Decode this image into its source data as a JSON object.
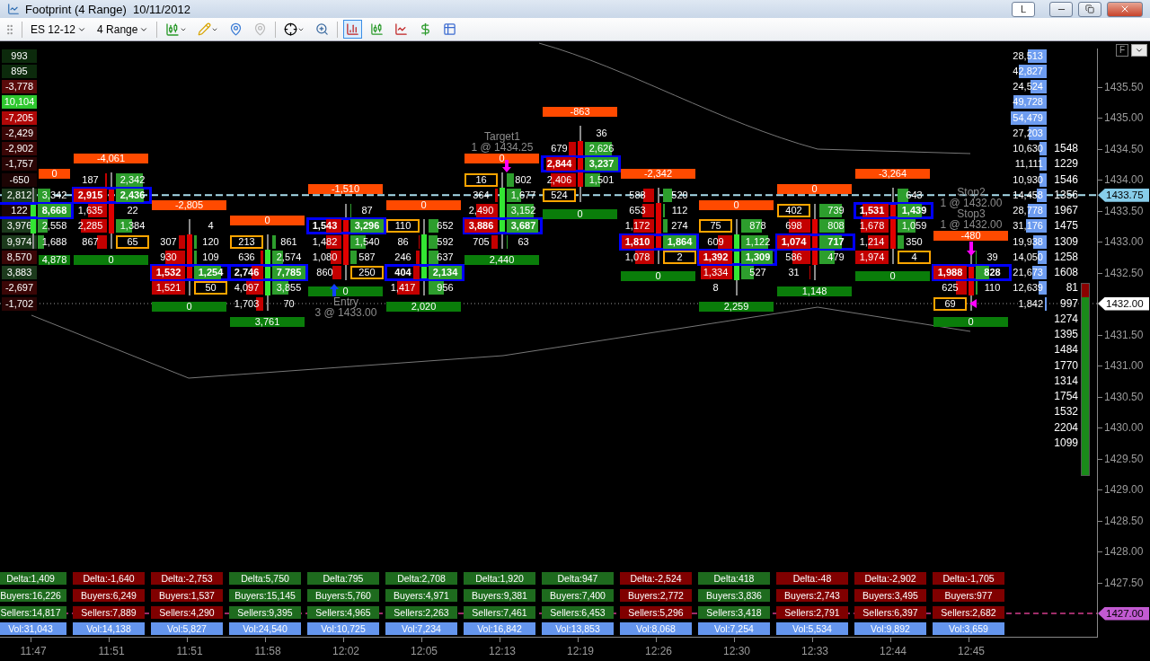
{
  "window": {
    "title": "Footprint (4 Range)  10/11/2012",
    "link_button": "L"
  },
  "toolbar": {
    "instrument": "ES 12-12",
    "period": "4 Range",
    "views": [
      {
        "selected": true
      },
      {
        "selected": false
      },
      {
        "selected": false
      },
      {
        "selected": false
      },
      {
        "selected": false
      }
    ]
  },
  "chart": {
    "scale_button": "F",
    "ladder": [
      {
        "value": "993",
        "color": "#0c2a0c"
      },
      {
        "value": "895",
        "color": "#0c2a0c"
      },
      {
        "value": "-3,778",
        "color": "#5a0a0a"
      },
      {
        "value": "10,104",
        "color": "#2fc82f"
      },
      {
        "value": "-7,205",
        "color": "#b00808"
      },
      {
        "value": "-2,429",
        "color": "#3a0606"
      },
      {
        "value": "-2,902",
        "color": "#3a0606"
      },
      {
        "value": "-1,757",
        "color": "#2a0505"
      },
      {
        "value": "-650",
        "color": "#1c0404"
      },
      {
        "value": "2,812",
        "color": "#1c3a1c"
      },
      {
        "value": "122",
        "color": "#1c0404"
      },
      {
        "value": "3,976",
        "color": "#1c3a1c"
      },
      {
        "value": "9,974",
        "color": "#1c3a1c"
      },
      {
        "value": "8,570",
        "color": "#3a0606"
      },
      {
        "value": "3,883",
        "color": "#1c3a1c"
      },
      {
        "value": "-2,697",
        "color": "#3a0606"
      },
      {
        "value": "-1,702",
        "color": "#2a0505"
      }
    ],
    "bars": [
      {
        "time": "11:47",
        "bullish": true,
        "delta": "0",
        "total": "4,878",
        "stats": {
          "color": "#1e6b1e",
          "delta": "Delta:1,409",
          "buyers": "Buyers:16,226",
          "sellers": "Sellers:14,817",
          "volume": "Vol:31,043"
        }
      },
      {
        "time": "11:51",
        "bullish": false,
        "delta": "-4,061",
        "total": "0",
        "stats": {
          "color": "#800000",
          "delta": "Delta:-1,640",
          "buyers": "Buyers:6,249",
          "sellers": "Sellers:7,889",
          "volume": "Vol:14,138"
        }
      },
      {
        "time": "11:51",
        "bullish": false,
        "delta": "-2,805",
        "total": "0",
        "stats": {
          "color": "#800000",
          "delta": "Delta:-2,753",
          "buyers": "Buyers:1,537",
          "sellers": "Sellers:4,290",
          "volume": "Vol:5,827"
        }
      },
      {
        "time": "11:58",
        "bullish": true,
        "delta": "0",
        "total": "3,761",
        "stats": {
          "color": "#1e6b1e",
          "delta": "Delta:5,750",
          "buyers": "Buyers:15,145",
          "sellers": "Sellers:9,395",
          "volume": "Vol:24,540"
        }
      },
      {
        "time": "12:02",
        "bullish": false,
        "delta": "-1,510",
        "total": "0",
        "orders": [
          {
            "kind": "entry",
            "name": "Entry",
            "detail": "3 @ 1433.00"
          }
        ],
        "stats": {
          "color": "#1e6b1e",
          "delta": "Delta:795",
          "buyers": "Buyers:5,760",
          "sellers": "Sellers:4,965",
          "volume": "Vol:10,725"
        }
      },
      {
        "time": "12:05",
        "bullish": true,
        "delta": "0",
        "total": "2,020",
        "stats": {
          "color": "#1e6b1e",
          "delta": "Delta:2,708",
          "buyers": "Buyers:4,971",
          "sellers": "Sellers:2,263",
          "volume": "Vol:7,234"
        }
      },
      {
        "time": "12:13",
        "bullish": true,
        "delta": "0",
        "total": "2,440",
        "orders": [
          {
            "kind": "target",
            "name": "Target1",
            "detail": "1 @ 1434.25"
          }
        ],
        "stats": {
          "color": "#1e6b1e",
          "delta": "Delta:1,920",
          "buyers": "Buyers:9,381",
          "sellers": "Sellers:7,461",
          "volume": "Vol:16,842"
        }
      },
      {
        "time": "12:19",
        "bullish": false,
        "delta": "-863",
        "total": "0",
        "stats": {
          "color": "#1e6b1e",
          "delta": "Delta:947",
          "buyers": "Buyers:7,400",
          "sellers": "Sellers:6,453",
          "volume": "Vol:13,853"
        }
      },
      {
        "time": "12:26",
        "bullish": false,
        "delta": "-2,342",
        "total": "0",
        "stats": {
          "color": "#800000",
          "delta": "Delta:-2,524",
          "buyers": "Buyers:2,772",
          "sellers": "Sellers:5,296",
          "volume": "Vol:8,068"
        }
      },
      {
        "time": "12:30",
        "bullish": true,
        "delta": "0",
        "total": "2,259",
        "stats": {
          "color": "#1e6b1e",
          "delta": "Delta:418",
          "buyers": "Buyers:3,836",
          "sellers": "Sellers:3,418",
          "volume": "Vol:7,254"
        }
      },
      {
        "time": "12:33",
        "bullish": false,
        "delta": "0",
        "total": "1,148",
        "stats": {
          "color": "#800000",
          "delta": "Delta:-48",
          "buyers": "Buyers:2,743",
          "sellers": "Sellers:2,791",
          "volume": "Vol:5,534"
        }
      },
      {
        "time": "12:44",
        "bullish": false,
        "delta": "-3,264",
        "total": "0",
        "stats": {
          "color": "#800000",
          "delta": "Delta:-2,902",
          "buyers": "Buyers:3,495",
          "sellers": "Sellers:6,397",
          "volume": "Vol:9,892"
        }
      },
      {
        "time": "12:45",
        "bullish": false,
        "delta": "-480",
        "total": "0",
        "orders": [
          {
            "kind": "stop",
            "name": "Stop2",
            "detail": "1 @ 1432.00"
          },
          {
            "kind": "stop",
            "name": "Stop3",
            "detail": "1 @ 1432.00"
          }
        ],
        "stats": {
          "color": "#800000",
          "delta": "Delta:-1,705",
          "buyers": "Buyers:977",
          "sellers": "Sellers:2,682",
          "volume": "Vol:3,659"
        }
      }
    ],
    "footprint_rows": [
      {
        "cells": [
          {
            "kind": "empty"
          },
          {
            "kind": "empty"
          },
          {
            "kind": "empty"
          },
          {
            "kind": "empty"
          },
          {
            "kind": "empty"
          },
          {
            "kind": "empty"
          },
          {
            "kind": "empty"
          },
          {
            "kind": "plain",
            "ask": "36"
          },
          {
            "kind": "empty"
          },
          {
            "kind": "empty"
          },
          {
            "kind": "empty"
          },
          {
            "kind": "empty"
          },
          {
            "kind": "empty"
          }
        ]
      },
      {
        "cells": [
          {
            "kind": "empty"
          },
          {
            "kind": "empty"
          },
          {
            "kind": "empty"
          },
          {
            "kind": "empty"
          },
          {
            "kind": "empty"
          },
          {
            "kind": "empty"
          },
          {
            "kind": "empty"
          },
          {
            "kind": "plain",
            "bid": "679",
            "ask": "2,626"
          },
          {
            "kind": "empty"
          },
          {
            "kind": "empty"
          },
          {
            "kind": "empty"
          },
          {
            "kind": "empty"
          },
          {
            "kind": "empty"
          }
        ]
      },
      {
        "cells": [
          {
            "kind": "empty"
          },
          {
            "kind": "empty"
          },
          {
            "kind": "empty"
          },
          {
            "kind": "empty"
          },
          {
            "kind": "empty"
          },
          {
            "kind": "empty"
          },
          {
            "kind": "empty"
          },
          {
            "kind": "both",
            "bid": "2,844",
            "ask": "3,237"
          },
          {
            "kind": "empty"
          },
          {
            "kind": "empty"
          },
          {
            "kind": "empty"
          },
          {
            "kind": "empty"
          },
          {
            "kind": "empty"
          }
        ]
      },
      {
        "cells": [
          {
            "kind": "empty"
          },
          {
            "kind": "plain",
            "bid": "187",
            "ask": "2,342"
          },
          {
            "kind": "empty"
          },
          {
            "kind": "empty"
          },
          {
            "kind": "empty"
          },
          {
            "kind": "empty"
          },
          {
            "kind": "bid",
            "bid": "16",
            "ask": "802"
          },
          {
            "kind": "plain",
            "bid": "2,406",
            "ask": "1,501"
          },
          {
            "kind": "empty"
          },
          {
            "kind": "empty"
          },
          {
            "kind": "empty"
          },
          {
            "kind": "empty"
          },
          {
            "kind": "empty"
          }
        ]
      },
      {
        "cells": [
          {
            "kind": "plain",
            "ask": "3,342"
          },
          {
            "kind": "both",
            "bid": "2,915",
            "ask": "2,436"
          },
          {
            "kind": "empty"
          },
          {
            "kind": "empty"
          },
          {
            "kind": "empty"
          },
          {
            "kind": "empty"
          },
          {
            "kind": "plain",
            "bid": "364",
            "ask": "1,677"
          },
          {
            "kind": "bid",
            "bid": "524"
          },
          {
            "kind": "plain",
            "bid": "588",
            "ask": "520"
          },
          {
            "kind": "empty"
          },
          {
            "kind": "empty"
          },
          {
            "kind": "plain",
            "ask": "643"
          },
          {
            "kind": "empty"
          }
        ]
      },
      {
        "cells": [
          {
            "kind": "both",
            "ask": "8,668"
          },
          {
            "kind": "plain",
            "bid": "1,635",
            "ask": "22"
          },
          {
            "kind": "empty"
          },
          {
            "kind": "empty"
          },
          {
            "kind": "plain",
            "ask": "87"
          },
          {
            "kind": "empty"
          },
          {
            "kind": "plain",
            "bid": "2,490",
            "ask": "3,152"
          },
          {
            "kind": "empty"
          },
          {
            "kind": "plain",
            "bid": "653",
            "ask": "112"
          },
          {
            "kind": "empty"
          },
          {
            "kind": "bid",
            "bid": "402",
            "ask": "739"
          },
          {
            "kind": "both",
            "bid": "1,531",
            "ask": "1,439"
          },
          {
            "kind": "empty"
          }
        ]
      },
      {
        "cells": [
          {
            "kind": "plain",
            "ask": "2,558"
          },
          {
            "kind": "plain",
            "bid": "2,285",
            "ask": "1,384"
          },
          {
            "kind": "plain",
            "ask": "4"
          },
          {
            "kind": "empty"
          },
          {
            "kind": "both",
            "bid": "1,543",
            "ask": "3,296"
          },
          {
            "kind": "bid",
            "bid": "110",
            "ask": "652"
          },
          {
            "kind": "both",
            "bid": "3,886",
            "ask": "3,687"
          },
          {
            "kind": "empty"
          },
          {
            "kind": "plain",
            "bid": "1,172",
            "ask": "274"
          },
          {
            "kind": "bid",
            "bid": "75",
            "ask": "878"
          },
          {
            "kind": "plain",
            "bid": "698",
            "ask": "808"
          },
          {
            "kind": "plain",
            "bid": "1,678",
            "ask": "1,059"
          },
          {
            "kind": "empty"
          }
        ]
      },
      {
        "cells": [
          {
            "kind": "plain",
            "ask": "1,688"
          },
          {
            "kind": "ask",
            "bid": "867",
            "ask": "65"
          },
          {
            "kind": "plain",
            "bid": "307",
            "ask": "120"
          },
          {
            "kind": "bid",
            "bid": "213",
            "ask": "861"
          },
          {
            "kind": "plain",
            "bid": "1,482",
            "ask": "1,540"
          },
          {
            "kind": "plain",
            "bid": "86",
            "ask": "592"
          },
          {
            "kind": "plain",
            "bid": "705",
            "ask": "63"
          },
          {
            "kind": "empty"
          },
          {
            "kind": "both",
            "bid": "1,810",
            "ask": "1,864"
          },
          {
            "kind": "plain",
            "bid": "609",
            "ask": "1,122"
          },
          {
            "kind": "both",
            "bid": "1,074",
            "ask": "717"
          },
          {
            "kind": "plain",
            "bid": "1,214",
            "ask": "350"
          },
          {
            "kind": "empty"
          }
        ]
      },
      {
        "cells": [
          {
            "kind": "empty"
          },
          {
            "kind": "empty"
          },
          {
            "kind": "plain",
            "bid": "930",
            "ask": "109"
          },
          {
            "kind": "plain",
            "bid": "636",
            "ask": "2,574"
          },
          {
            "kind": "plain",
            "bid": "1,080",
            "ask": "587"
          },
          {
            "kind": "plain",
            "bid": "246",
            "ask": "637"
          },
          {
            "kind": "empty"
          },
          {
            "kind": "empty"
          },
          {
            "kind": "ask",
            "bid": "1,078",
            "ask": "2"
          },
          {
            "kind": "both",
            "bid": "1,392",
            "ask": "1,309"
          },
          {
            "kind": "plain",
            "bid": "586",
            "ask": "479"
          },
          {
            "kind": "ask",
            "bid": "1,974",
            "ask": "4"
          },
          {
            "kind": "plain",
            "ask": "39"
          }
        ]
      },
      {
        "cells": [
          {
            "kind": "empty"
          },
          {
            "kind": "empty"
          },
          {
            "kind": "both",
            "bid": "1,532",
            "ask": "1,254"
          },
          {
            "kind": "both",
            "bid": "2,746",
            "ask": "7,785"
          },
          {
            "kind": "ask",
            "bid": "860",
            "ask": "250"
          },
          {
            "kind": "both",
            "bid": "404",
            "ask": "2,134"
          },
          {
            "kind": "empty"
          },
          {
            "kind": "empty"
          },
          {
            "kind": "empty"
          },
          {
            "kind": "plain",
            "bid": "1,334",
            "ask": "527"
          },
          {
            "kind": "plain",
            "bid": "31"
          },
          {
            "kind": "empty"
          },
          {
            "kind": "both",
            "bid": "1,988",
            "ask": "828"
          }
        ]
      },
      {
        "cells": [
          {
            "kind": "empty"
          },
          {
            "kind": "empty"
          },
          {
            "kind": "ask",
            "bid": "1,521",
            "ask": "50"
          },
          {
            "kind": "plain",
            "bid": "4,097",
            "ask": "3,855"
          },
          {
            "kind": "empty"
          },
          {
            "kind": "plain",
            "bid": "1,417",
            "ask": "956"
          },
          {
            "kind": "empty"
          },
          {
            "kind": "empty"
          },
          {
            "kind": "empty"
          },
          {
            "kind": "plain",
            "bid": "8"
          },
          {
            "kind": "empty"
          },
          {
            "kind": "empty"
          },
          {
            "kind": "plain",
            "bid": "625",
            "ask": "110"
          }
        ]
      },
      {
        "cells": [
          {
            "kind": "empty"
          },
          {
            "kind": "empty"
          },
          {
            "kind": "empty"
          },
          {
            "kind": "plain",
            "bid": "1,703",
            "ask": "70"
          },
          {
            "kind": "empty"
          },
          {
            "kind": "empty"
          },
          {
            "kind": "empty"
          },
          {
            "kind": "empty"
          },
          {
            "kind": "empty"
          },
          {
            "kind": "empty"
          },
          {
            "kind": "empty"
          },
          {
            "kind": "empty"
          },
          {
            "kind": "bid",
            "bid": "69"
          }
        ]
      }
    ],
    "volume_profile": [
      "28,513",
      "42,827",
      "24,524",
      "49,728",
      "54,479",
      "27,203",
      "10,630",
      "11,111",
      "10,930",
      "14,458",
      "28,778",
      "31,176",
      "19,938",
      "14,050",
      "21,673",
      "12,639",
      "1,842"
    ],
    "depth": [
      "1548",
      "1229",
      "1546",
      "1356",
      "1967",
      "1475",
      "1309",
      "1258",
      "1608",
      "81",
      "997",
      "1274",
      "1395",
      "1484",
      "1770",
      "1314",
      "1754",
      "1532",
      "2204",
      "1099"
    ],
    "price_axis": {
      "ticks": [
        "1435.50",
        "1435.00",
        "1434.50",
        "1434.00",
        "1433.50",
        "1433.00",
        "1432.50",
        "1431.50",
        "1431.00",
        "1430.50",
        "1430.00",
        "1429.50",
        "1429.00",
        "1428.50",
        "1428.00",
        "1427.50"
      ],
      "markers": [
        {
          "kind": "last",
          "value": "1433.75"
        },
        {
          "kind": "position",
          "value": "1432.00"
        },
        {
          "kind": "alert",
          "value": "1427.00"
        }
      ]
    }
  }
}
